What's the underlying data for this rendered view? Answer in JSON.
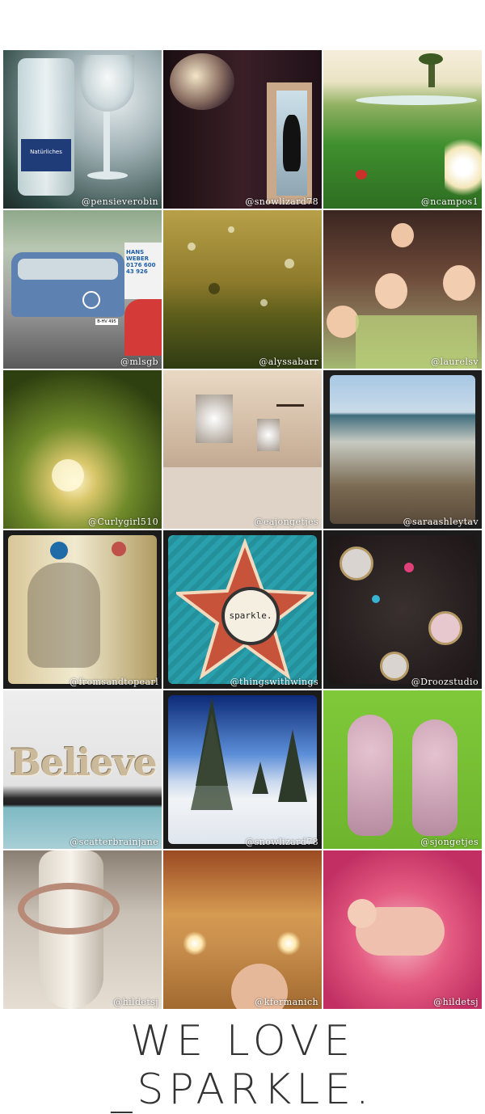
{
  "gallery": {
    "tiles": [
      {
        "handle": "@pensieverobin",
        "bottle_label": "Natürliches"
      },
      {
        "handle": "@snowlizard78"
      },
      {
        "handle": "@ncampos1"
      },
      {
        "handle": "@mlsgb",
        "van_sign": "HANS WEBER",
        "van_phone": "0176 600 43 926",
        "plate": "B-HV 495"
      },
      {
        "handle": "@alyssabarr"
      },
      {
        "handle": "@laurelsv"
      },
      {
        "handle": "@Curlygirl510"
      },
      {
        "handle": "@eajongetjes"
      },
      {
        "handle": "@saraashleytav"
      },
      {
        "handle": "@fromsandtopearl"
      },
      {
        "handle": "@thingswithwings",
        "badge_text": "sparkle."
      },
      {
        "handle": "@Droozstudio"
      },
      {
        "handle": "@scatterbrainjane",
        "sign_text": "Believe"
      },
      {
        "handle": "@snowlizard78"
      },
      {
        "handle": "@sjongetjes"
      },
      {
        "handle": "@hildetsj"
      },
      {
        "handle": "@kfermanich"
      },
      {
        "handle": "@hildetsj"
      }
    ]
  },
  "caption": {
    "text": "WE LOVE _SPARKLE."
  }
}
